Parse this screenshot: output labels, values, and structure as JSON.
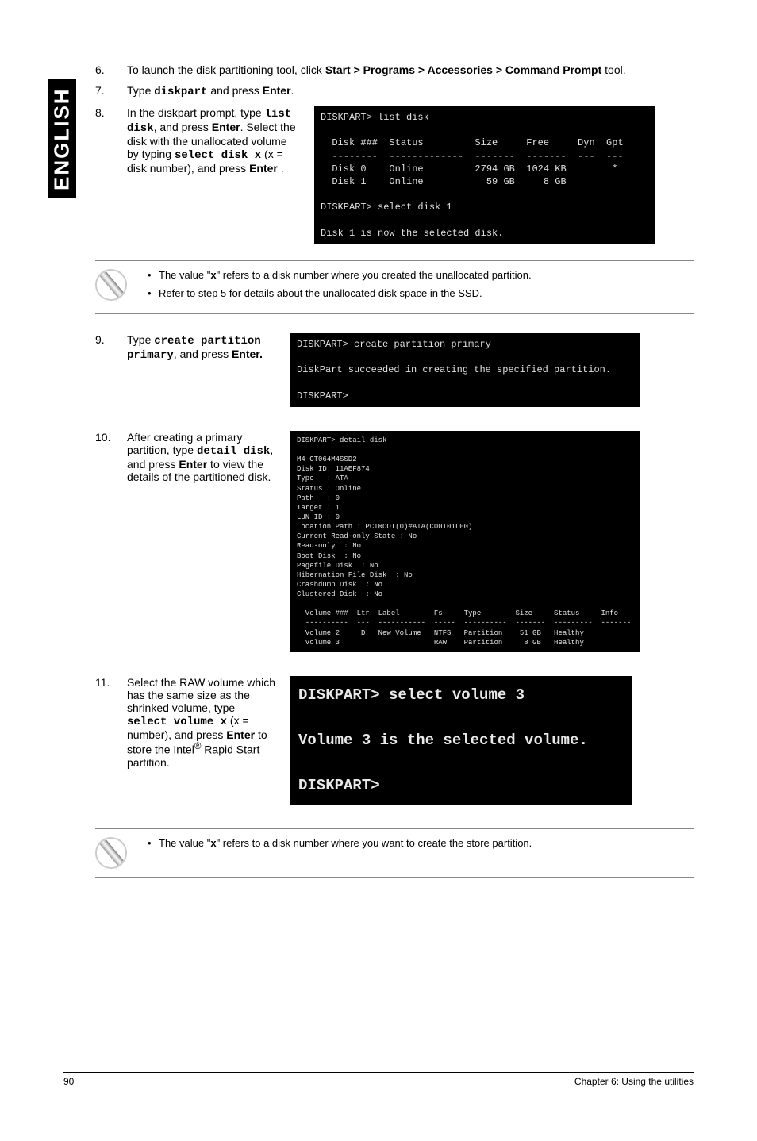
{
  "side_tab": "ENGLISH",
  "step6": {
    "num": "6.",
    "text_a": "To launch the disk partitioning tool, click ",
    "text_b": "Start > Programs > Accessories > Command Prompt",
    "text_c": " tool."
  },
  "step7": {
    "num": "7.",
    "text_a": "Type ",
    "code": "diskpart",
    "text_b": " and press ",
    "text_c": "Enter",
    "text_d": "."
  },
  "step8": {
    "num": "8.",
    "text_a": "In the diskpart prompt, type ",
    "code1": "list disk",
    "text_b": ", and press ",
    "enter1": "Enter",
    "text_c": ". Select the disk with the unallocated volume by typing ",
    "code2": "select disk x",
    "text_d": " (x = disk number), and press ",
    "enter2": "Enter",
    "text_e": " ."
  },
  "console1": "DISKPART> list disk\n\n  Disk ###  Status         Size     Free     Dyn  Gpt\n  --------  -------------  -------  -------  ---  ---\n  Disk 0    Online         2794 GB  1024 KB        *\n  Disk 1    Online           59 GB     8 GB\n\nDISKPART> select disk 1\n\nDisk 1 is now the selected disk.",
  "note1": {
    "b1a": "The value \"",
    "b1b": "x",
    "b1c": "\" refers to a disk number where you created the unallocated partition.",
    "b2": "Refer to step 5 for details about the unallocated disk space in the SSD."
  },
  "step9": {
    "num": "9.",
    "text_a": "Type ",
    "code": "create partition primary",
    "text_b": ", and press ",
    "enter": "Enter."
  },
  "console2": "DISKPART> create partition primary\n\nDiskPart succeeded in creating the specified partition.\n\nDISKPART>",
  "step10": {
    "num": "10.",
    "text_a": "After creating a primary partition, type ",
    "code": "detail disk",
    "text_b": ", and press ",
    "enter": "Enter",
    "text_c": " to view the details of the partitioned disk."
  },
  "console3": "DISKPART> detail disk\n\nM4-CT064M4SSD2\nDisk ID: 11AEF874\nType   : ATA\nStatus : Online\nPath   : 0\nTarget : 1\nLUN ID : 0\nLocation Path : PCIROOT(0)#ATA(C00T01L00)\nCurrent Read-only State : No\nRead-only  : No\nBoot Disk  : No\nPagefile Disk  : No\nHibernation File Disk  : No\nCrashdump Disk  : No\nClustered Disk  : No\n\n  Volume ###  Ltr  Label        Fs     Type        Size     Status     Info\n  ----------  ---  -----------  -----  ----------  -------  ---------  -------\n  Volume 2     D   New Volume   NTFS   Partition    51 GB   Healthy\n  Volume 3                      RAW    Partition     8 GB   Healthy",
  "step11": {
    "num": "11.",
    "text_a": "Select the RAW volume which has the same size as the shrinked volume, type ",
    "code": "select volume x",
    "text_b": " (x = number), and press ",
    "enter": "Enter",
    "text_c": " to store the Intel",
    "reg": "®",
    "text_d": " Rapid Start partition."
  },
  "console4": "DISKPART> select volume 3\n\nVolume 3 is the selected volume.\n\nDISKPART>",
  "note2": {
    "b1a": "The value \"",
    "b1b": "x",
    "b1c": "\" refers to a disk number where you want to create the store partition."
  },
  "footer": {
    "page": "90",
    "chapter": "Chapter 6: Using the utilities"
  }
}
